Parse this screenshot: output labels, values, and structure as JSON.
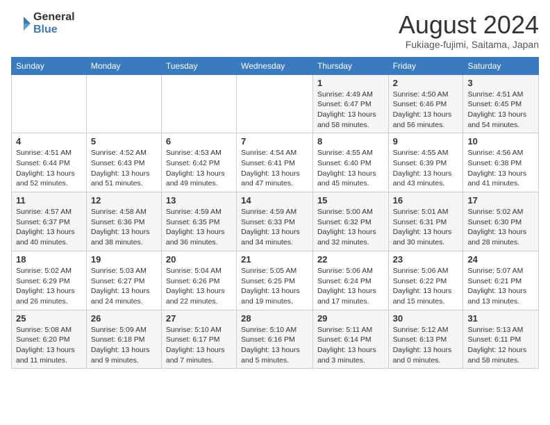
{
  "logo": {
    "general": "General",
    "blue": "Blue"
  },
  "title": "August 2024",
  "subtitle": "Fukiage-fujimi, Saitama, Japan",
  "days_of_week": [
    "Sunday",
    "Monday",
    "Tuesday",
    "Wednesday",
    "Thursday",
    "Friday",
    "Saturday"
  ],
  "weeks": [
    [
      {
        "day": "",
        "detail": ""
      },
      {
        "day": "",
        "detail": ""
      },
      {
        "day": "",
        "detail": ""
      },
      {
        "day": "",
        "detail": ""
      },
      {
        "day": "1",
        "detail": "Sunrise: 4:49 AM\nSunset: 6:47 PM\nDaylight: 13 hours\nand 58 minutes."
      },
      {
        "day": "2",
        "detail": "Sunrise: 4:50 AM\nSunset: 6:46 PM\nDaylight: 13 hours\nand 56 minutes."
      },
      {
        "day": "3",
        "detail": "Sunrise: 4:51 AM\nSunset: 6:45 PM\nDaylight: 13 hours\nand 54 minutes."
      }
    ],
    [
      {
        "day": "4",
        "detail": "Sunrise: 4:51 AM\nSunset: 6:44 PM\nDaylight: 13 hours\nand 52 minutes."
      },
      {
        "day": "5",
        "detail": "Sunrise: 4:52 AM\nSunset: 6:43 PM\nDaylight: 13 hours\nand 51 minutes."
      },
      {
        "day": "6",
        "detail": "Sunrise: 4:53 AM\nSunset: 6:42 PM\nDaylight: 13 hours\nand 49 minutes."
      },
      {
        "day": "7",
        "detail": "Sunrise: 4:54 AM\nSunset: 6:41 PM\nDaylight: 13 hours\nand 47 minutes."
      },
      {
        "day": "8",
        "detail": "Sunrise: 4:55 AM\nSunset: 6:40 PM\nDaylight: 13 hours\nand 45 minutes."
      },
      {
        "day": "9",
        "detail": "Sunrise: 4:55 AM\nSunset: 6:39 PM\nDaylight: 13 hours\nand 43 minutes."
      },
      {
        "day": "10",
        "detail": "Sunrise: 4:56 AM\nSunset: 6:38 PM\nDaylight: 13 hours\nand 41 minutes."
      }
    ],
    [
      {
        "day": "11",
        "detail": "Sunrise: 4:57 AM\nSunset: 6:37 PM\nDaylight: 13 hours\nand 40 minutes."
      },
      {
        "day": "12",
        "detail": "Sunrise: 4:58 AM\nSunset: 6:36 PM\nDaylight: 13 hours\nand 38 minutes."
      },
      {
        "day": "13",
        "detail": "Sunrise: 4:59 AM\nSunset: 6:35 PM\nDaylight: 13 hours\nand 36 minutes."
      },
      {
        "day": "14",
        "detail": "Sunrise: 4:59 AM\nSunset: 6:33 PM\nDaylight: 13 hours\nand 34 minutes."
      },
      {
        "day": "15",
        "detail": "Sunrise: 5:00 AM\nSunset: 6:32 PM\nDaylight: 13 hours\nand 32 minutes."
      },
      {
        "day": "16",
        "detail": "Sunrise: 5:01 AM\nSunset: 6:31 PM\nDaylight: 13 hours\nand 30 minutes."
      },
      {
        "day": "17",
        "detail": "Sunrise: 5:02 AM\nSunset: 6:30 PM\nDaylight: 13 hours\nand 28 minutes."
      }
    ],
    [
      {
        "day": "18",
        "detail": "Sunrise: 5:02 AM\nSunset: 6:29 PM\nDaylight: 13 hours\nand 26 minutes."
      },
      {
        "day": "19",
        "detail": "Sunrise: 5:03 AM\nSunset: 6:27 PM\nDaylight: 13 hours\nand 24 minutes."
      },
      {
        "day": "20",
        "detail": "Sunrise: 5:04 AM\nSunset: 6:26 PM\nDaylight: 13 hours\nand 22 minutes."
      },
      {
        "day": "21",
        "detail": "Sunrise: 5:05 AM\nSunset: 6:25 PM\nDaylight: 13 hours\nand 19 minutes."
      },
      {
        "day": "22",
        "detail": "Sunrise: 5:06 AM\nSunset: 6:24 PM\nDaylight: 13 hours\nand 17 minutes."
      },
      {
        "day": "23",
        "detail": "Sunrise: 5:06 AM\nSunset: 6:22 PM\nDaylight: 13 hours\nand 15 minutes."
      },
      {
        "day": "24",
        "detail": "Sunrise: 5:07 AM\nSunset: 6:21 PM\nDaylight: 13 hours\nand 13 minutes."
      }
    ],
    [
      {
        "day": "25",
        "detail": "Sunrise: 5:08 AM\nSunset: 6:20 PM\nDaylight: 13 hours\nand 11 minutes."
      },
      {
        "day": "26",
        "detail": "Sunrise: 5:09 AM\nSunset: 6:18 PM\nDaylight: 13 hours\nand 9 minutes."
      },
      {
        "day": "27",
        "detail": "Sunrise: 5:10 AM\nSunset: 6:17 PM\nDaylight: 13 hours\nand 7 minutes."
      },
      {
        "day": "28",
        "detail": "Sunrise: 5:10 AM\nSunset: 6:16 PM\nDaylight: 13 hours\nand 5 minutes."
      },
      {
        "day": "29",
        "detail": "Sunrise: 5:11 AM\nSunset: 6:14 PM\nDaylight: 13 hours\nand 3 minutes."
      },
      {
        "day": "30",
        "detail": "Sunrise: 5:12 AM\nSunset: 6:13 PM\nDaylight: 13 hours\nand 0 minutes."
      },
      {
        "day": "31",
        "detail": "Sunrise: 5:13 AM\nSunset: 6:11 PM\nDaylight: 12 hours\nand 58 minutes."
      }
    ]
  ]
}
